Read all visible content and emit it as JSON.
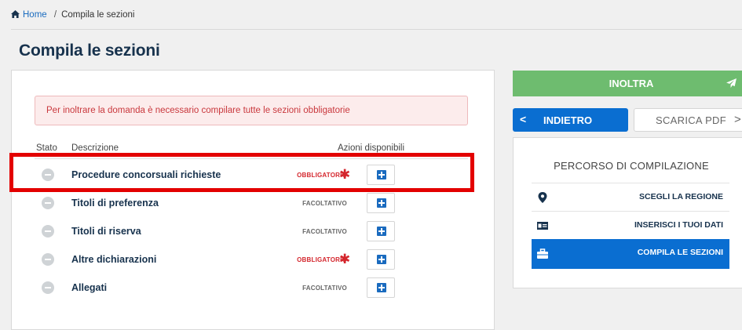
{
  "breadcrumb": {
    "home": "Home",
    "separator": "/",
    "current": "Compila le sezioni"
  },
  "page_title": "Compila le sezioni",
  "alert": "Per inoltrare la domanda è necessario compilare tutte le sezioni obbligatorie",
  "table": {
    "headers": {
      "status": "Stato",
      "description": "Descrizione",
      "actions": "Azioni disponibili"
    },
    "rows": [
      {
        "description": "Procedure concorsuali richieste",
        "badge": "OBBLIGATORIO",
        "required": true
      },
      {
        "description": "Titoli di preferenza",
        "badge": "FACOLTATIVO",
        "required": false
      },
      {
        "description": "Titoli di riserva",
        "badge": "FACOLTATIVO",
        "required": false
      },
      {
        "description": "Altre dichiarazioni",
        "badge": "OBBLIGATORIO",
        "required": true
      },
      {
        "description": "Allegati",
        "badge": "FACOLTATIVO",
        "required": false
      }
    ],
    "asterisk": "✱"
  },
  "actions": {
    "inoltra": "INOLTRA",
    "indietro": "INDIETRO",
    "indietro_chevron": "<",
    "scarica_pdf": "SCARICA PDF",
    "pdf_chevron": ">"
  },
  "side": {
    "title": "PERCORSO DI COMPILAZIONE",
    "steps": [
      {
        "label": "SCEGLI LA REGIONE",
        "icon": "map-marker-icon"
      },
      {
        "label": "INSERISCI I TUOI DATI",
        "icon": "id-card-icon"
      },
      {
        "label": "COMPILA LE SEZIONI",
        "icon": "briefcase-icon",
        "active": true
      }
    ]
  },
  "colors": {
    "primary": "#0a6ed1",
    "success": "#6ebc6f",
    "danger": "#d4262d",
    "title": "#17324d",
    "highlight": "#e30000"
  }
}
